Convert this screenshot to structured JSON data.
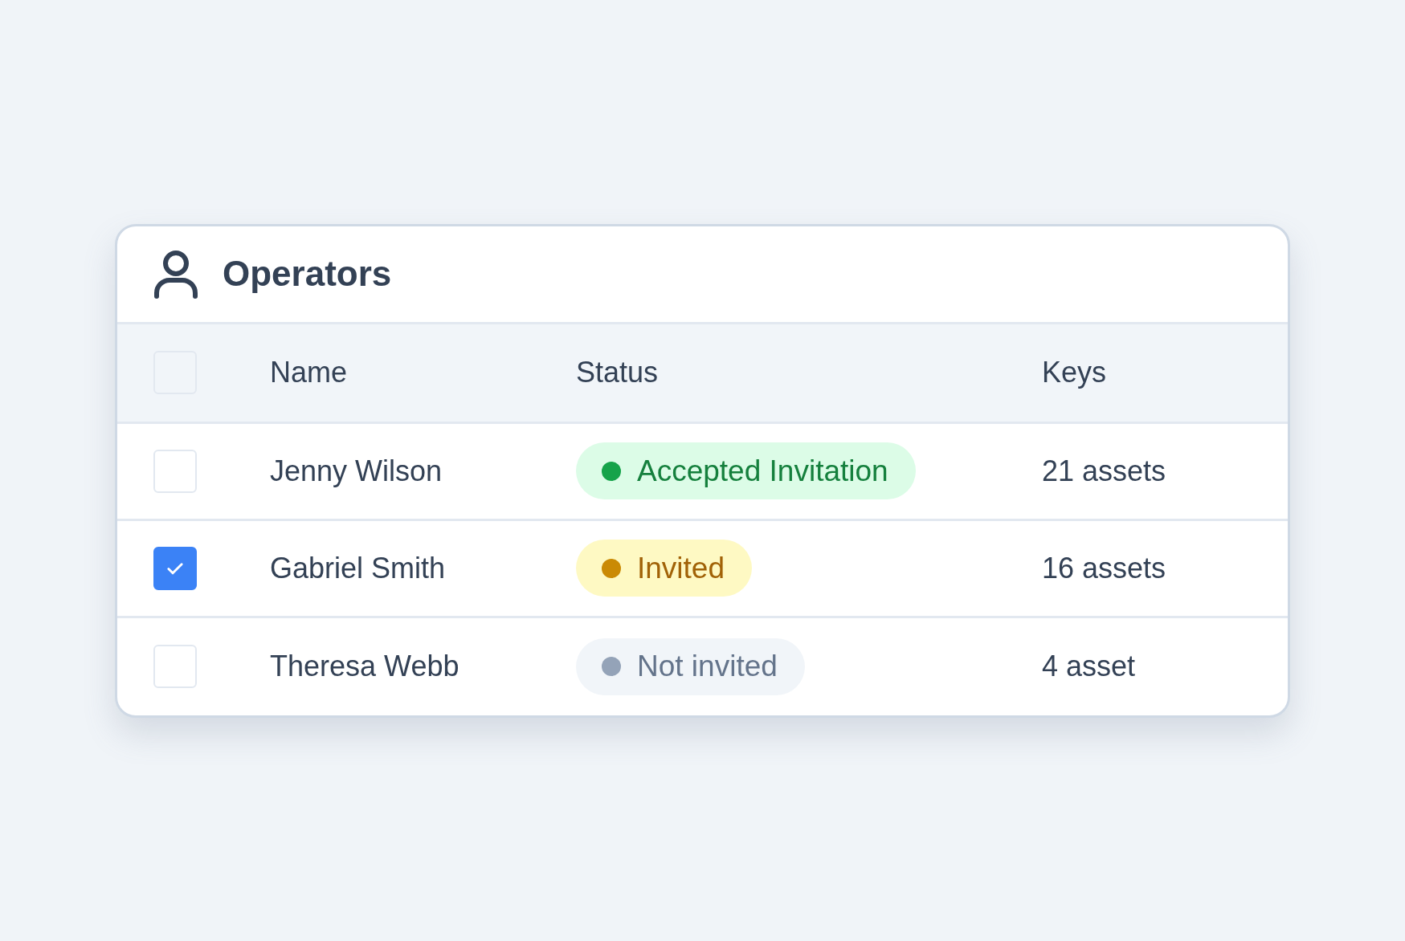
{
  "card": {
    "title": "Operators"
  },
  "table": {
    "header": {
      "checked": false,
      "columns": [
        "Name",
        "Status",
        "Keys"
      ]
    },
    "rows": [
      {
        "checked": false,
        "name": "Jenny Wilson",
        "status": {
          "label": "Accepted Invitation",
          "kind": "accepted",
          "color": "#16a34a"
        },
        "keys": "21 assets"
      },
      {
        "checked": true,
        "name": "Gabriel Smith",
        "status": {
          "label": "Invited",
          "kind": "invited",
          "color": "#ca8a04"
        },
        "keys": "16 assets"
      },
      {
        "checked": false,
        "name": "Theresa Webb",
        "status": {
          "label": "Not invited",
          "kind": "none",
          "color": "#94a3b8"
        },
        "keys": "4 asset"
      }
    ]
  }
}
